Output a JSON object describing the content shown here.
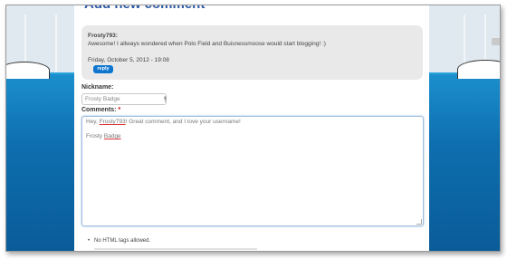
{
  "page": {
    "heading": "Add new comment"
  },
  "parent_comment": {
    "author": "Frosty793:",
    "text": "Awesome! I allways wondered when Polo Field and Buisnessmoose would start blogging! :)",
    "date": "Friday, October 5, 2012 - 19:08",
    "reply_label": "reply"
  },
  "form": {
    "nickname_label": "Nickname:",
    "nickname_value": "Frosty Badge",
    "comments_label": "Comments:",
    "required_mark": "*",
    "comment_line1_pre": "Hey, ",
    "comment_line1_name": "Frosty793",
    "comment_line1_post": "! Great comment, and I love your username!",
    "comment_line2_pre": "Frosty ",
    "comment_line2_word": "Badge",
    "tip": "No HTML tags allowed."
  },
  "colors": {
    "heading": "#2a57a4",
    "reply_button": "#0e76cf",
    "water": "#1b8fcd"
  }
}
